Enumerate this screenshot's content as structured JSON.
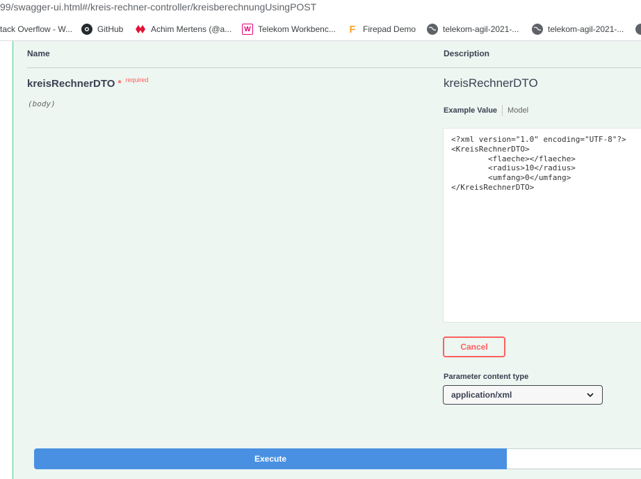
{
  "browser": {
    "url": "99/swagger-ui.html#/kreis-rechner-controller/kreisberechnungUsingPOST",
    "bookmarks": [
      {
        "label": "tack Overflow - W...",
        "icon": "stackoverflow-icon"
      },
      {
        "label": "GitHub",
        "icon": "github-icon"
      },
      {
        "label": "Achim Mertens (@a...",
        "icon": "hive-icon"
      },
      {
        "label": "Telekom Workbenc...",
        "icon": "telekom-workbench-icon"
      },
      {
        "label": "Firepad Demo",
        "icon": "firepad-icon"
      },
      {
        "label": "telekom-agil-2021-...",
        "icon": "globe-icon"
      },
      {
        "label": "telekom-agil-2021-...",
        "icon": "globe-icon"
      }
    ]
  },
  "params": {
    "header_name": "Name",
    "header_description": "Description",
    "name": "kreisRechnerDTO",
    "required_star": "*",
    "required_label": "required",
    "location": "(body)",
    "description_title": "kreisRechnerDTO",
    "tab_example": "Example Value",
    "tab_model": "Model",
    "example_value": "<?xml version=\"1.0\" encoding=\"UTF-8\"?>\n<KreisRechnerDTO>\n\t<flaeche></flaeche>\n\t<radius>10</radius>\n\t<umfang>0</umfang>\n</KreisRechnerDTO>",
    "cancel_label": "Cancel",
    "content_type_label": "Parameter content type",
    "content_type_value": "application/xml"
  },
  "actions": {
    "execute_label": "Execute"
  },
  "colors": {
    "panel_bg": "#edf6f1",
    "accent_green": "#49cc90",
    "danger_red": "#ff6060",
    "execute_blue": "#4990e2"
  }
}
